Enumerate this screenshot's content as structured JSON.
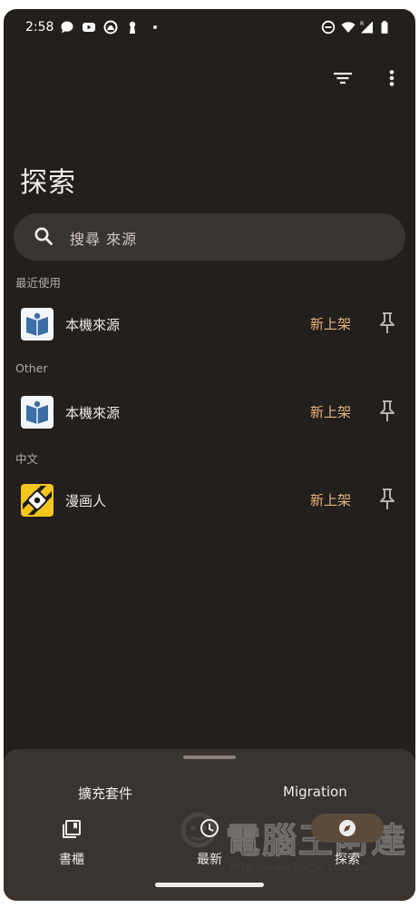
{
  "status_bar": {
    "time": "2:58",
    "left_icons": [
      "chat-bubble-icon",
      "youtube-icon",
      "app-notification-icon",
      "keyhole-icon",
      "dot"
    ],
    "right_icons": [
      "do-not-disturb-icon",
      "wifi-icon",
      "signal-icon",
      "battery-icon"
    ]
  },
  "toolbar": {
    "filter_icon": "filter-icon",
    "more_icon": "more-vert-icon"
  },
  "page": {
    "title": "探索"
  },
  "search": {
    "placeholder": "搜尋 來源"
  },
  "sections": [
    {
      "header": "最近使用",
      "items": [
        {
          "name": "本機來源",
          "icon": "local-source-book-icon",
          "action_label": "新上架"
        }
      ]
    },
    {
      "header": "Other",
      "items": [
        {
          "name": "本機來源",
          "icon": "local-source-book-icon",
          "action_label": "新上架"
        }
      ]
    },
    {
      "header": "中文",
      "items": [
        {
          "name": "漫画人",
          "icon": "manhuaren-logo-icon",
          "action_label": "新上架"
        }
      ]
    }
  ],
  "bottom_sheet": {
    "tabs": [
      "擴充套件",
      "Migration"
    ]
  },
  "bottom_nav": [
    {
      "label": "書櫃",
      "icon": "library-icon"
    },
    {
      "label": "最新",
      "icon": "clock-icon"
    },
    {
      "label": "探索",
      "icon": "compass-icon",
      "selected": true
    }
  ],
  "watermark": {
    "text": "電腦王阿達",
    "url": "http://www.kocpc.com.tw"
  },
  "colors": {
    "background": "#231f1d",
    "accent": "#e8b47a",
    "sheet": "#3a3431",
    "selected_pill": "#5c4a3b"
  }
}
